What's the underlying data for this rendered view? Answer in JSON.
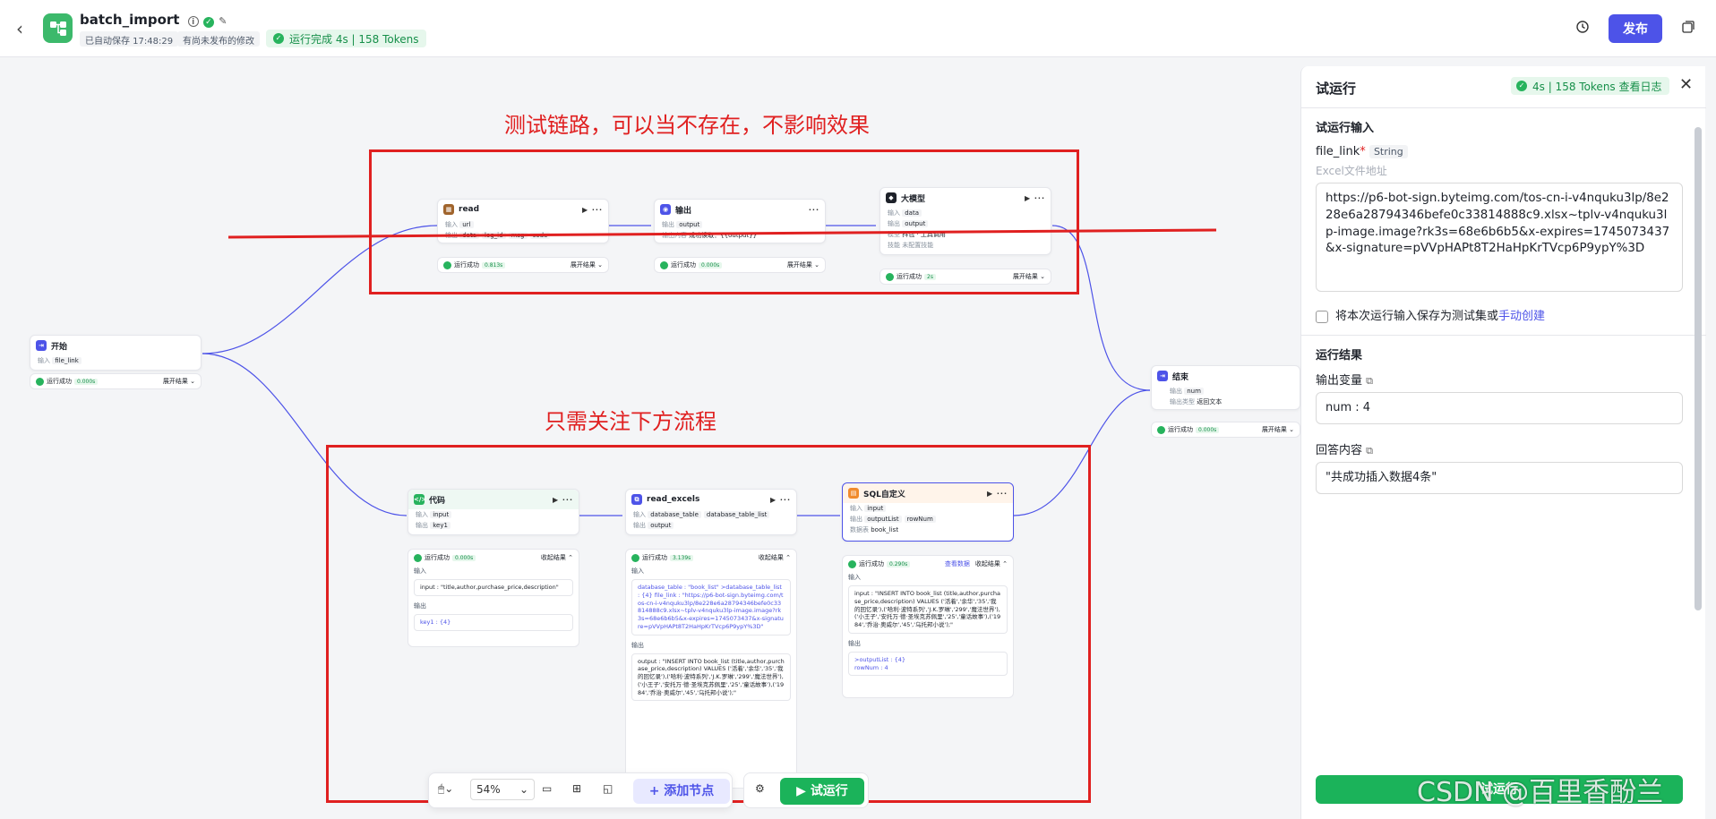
{
  "header": {
    "back": "‹",
    "title": "batch_import",
    "autosave": "已自动保存 17:48:29",
    "unpublished": "有尚未发布的修改",
    "run_status": "运行完成 4s | 158 Tokens",
    "publish": "发布"
  },
  "annotations": {
    "top": "测试链路，可以当不存在，不影响效果",
    "bottom": "只需关注下方流程"
  },
  "nodes": {
    "start": {
      "title": "开始",
      "in_label": "输入",
      "in_var": "file_link",
      "status": "运行成功",
      "time": "0.000s",
      "expand": "展开结果 ⌄"
    },
    "read": {
      "title": "read",
      "in_label": "输入",
      "in_var": "url",
      "out_label": "输出",
      "outs": [
        "data",
        "log_id",
        "msg",
        "code"
      ],
      "status": "运行成功",
      "time": "0.813s",
      "expand": "展开结果 ⌄"
    },
    "output": {
      "title": "输出",
      "out_label": "输出",
      "out_var": "output",
      "fmt_label": "输出内容",
      "fmt": "成功读取：{{output}}",
      "status": "运行成功",
      "time": "0.000s",
      "expand": "展开结果 ⌄"
    },
    "llm": {
      "title": "大模型",
      "in_label": "输入",
      "in_var": "data",
      "out_label": "输出",
      "out_var": "output",
      "model_label": "模型",
      "model": "抖包 · 工具调用",
      "skill_label": "技能",
      "skill": "未配置技能",
      "status": "运行成功",
      "time": "2s",
      "expand": "展开结果 ⌄"
    },
    "end": {
      "title": "结束",
      "in_label": "输出",
      "in_var": "num",
      "mode_label": "输出类型",
      "mode": "返回文本",
      "status": "运行成功",
      "time": "0.000s",
      "expand": "展开结果 ⌄"
    },
    "code": {
      "title": "代码",
      "in_label": "输入",
      "in_var": "input",
      "out_label": "输出",
      "out_var": "key1",
      "status": "运行成功",
      "time": "0.000s",
      "collapse": "收起结果 ⌃",
      "input_label": "输入",
      "input_val": "input : \"title,author,purchase_price,description\"",
      "output_label": "输出",
      "output_val": "key1 : {4}"
    },
    "read_excels": {
      "title": "read_excels",
      "in_label": "输入",
      "in_vars": [
        "database_table",
        "database_table_list"
      ],
      "out_label": "输出",
      "out_var": "output",
      "status": "运行成功",
      "time": "3.139s",
      "collapse": "收起结果 ⌃",
      "input_label": "输入",
      "input_val": "database_table : \"book_list\" >database_table_list : {4} file_link : \"https://p6-bot-sign.byteimg.com/tos-cn-i-v4nquku3lp/8e228e6a28794346befe0c33814888c9.xlsx~tplv-v4nquku3lp-image.image?rk3s=68e6b6b5&x-expires=1745073437&x-signature=pVVpHAPt8T2HaHpKrTVcp6P9ypY%3D\"",
      "output_label": "输出",
      "output_val": "output : \"INSERT INTO book_list (title,author,purchase_price,description) VALUES ('活着','余华','35','我的回忆录'),('哈利·波特系列','J.K.罗琳','299','魔法世界'),('小王子','安托万·德·圣埃克苏佩里','25','童话故事'),('1984','乔治·奥威尔','45','乌托邦小说');\""
    },
    "sql": {
      "title": "SQL自定义",
      "in_label": "输入",
      "in_var": "input",
      "out_label": "输出",
      "outs": [
        "outputList",
        "rowNum"
      ],
      "db_label": "数据表",
      "db": "book_list",
      "status": "运行成功",
      "time": "0.290s",
      "view": "查看数据",
      "collapse": "收起结果 ⌃",
      "input_label": "输入",
      "input_val": "input : \"INSERT INTO book_list (title,author,purchase_price,description) VALUES ('活着','余华','35','我的回忆录'),('哈利·波特系列','J.K.罗琳','299','魔法世界'),('小王子','安托万·德·圣埃克苏佩里','25','童话故事'),('1984','乔治·奥威尔','45','乌托邦小说');\"",
      "output_label": "输出",
      "output_val1": ">outputList : {4}",
      "output_val2": "rowNum : 4"
    }
  },
  "toolbar": {
    "zoom": "54%",
    "add_node": "+ 添加节点",
    "trial_run": "▶ 试运行"
  },
  "panel": {
    "title": "试运行",
    "stat": "4s | 158 Tokens  查看日志",
    "input_section": "试运行输入",
    "field_name": "file_link",
    "field_type": "String",
    "field_hint": "Excel文件地址",
    "field_value": "https://p6-bot-sign.byteimg.com/tos-cn-i-v4nquku3lp/8e228e6a28794346befe0c33814888c9.xlsx~tplv-v4nquku3lp-image.image?rk3s=68e6b6b5&x-expires=1745073437&x-signature=pVVpHAPt8T2HaHpKrTVcp6P9ypY%3D",
    "save_label": "将本次运行输入保存为测试集或",
    "save_link": "手动创建",
    "result_section": "运行结果",
    "out_var_label": "输出变量",
    "out_var_value": "num : 4",
    "answer_label": "回答内容",
    "answer_value": "\"共成功插入数据4条\"",
    "run_button": "试运行"
  },
  "watermark": "CSDN @百里香酚兰",
  "colors": {
    "accent": "#4d53e8",
    "success": "#1bb35a",
    "annotation": "#e02020"
  }
}
